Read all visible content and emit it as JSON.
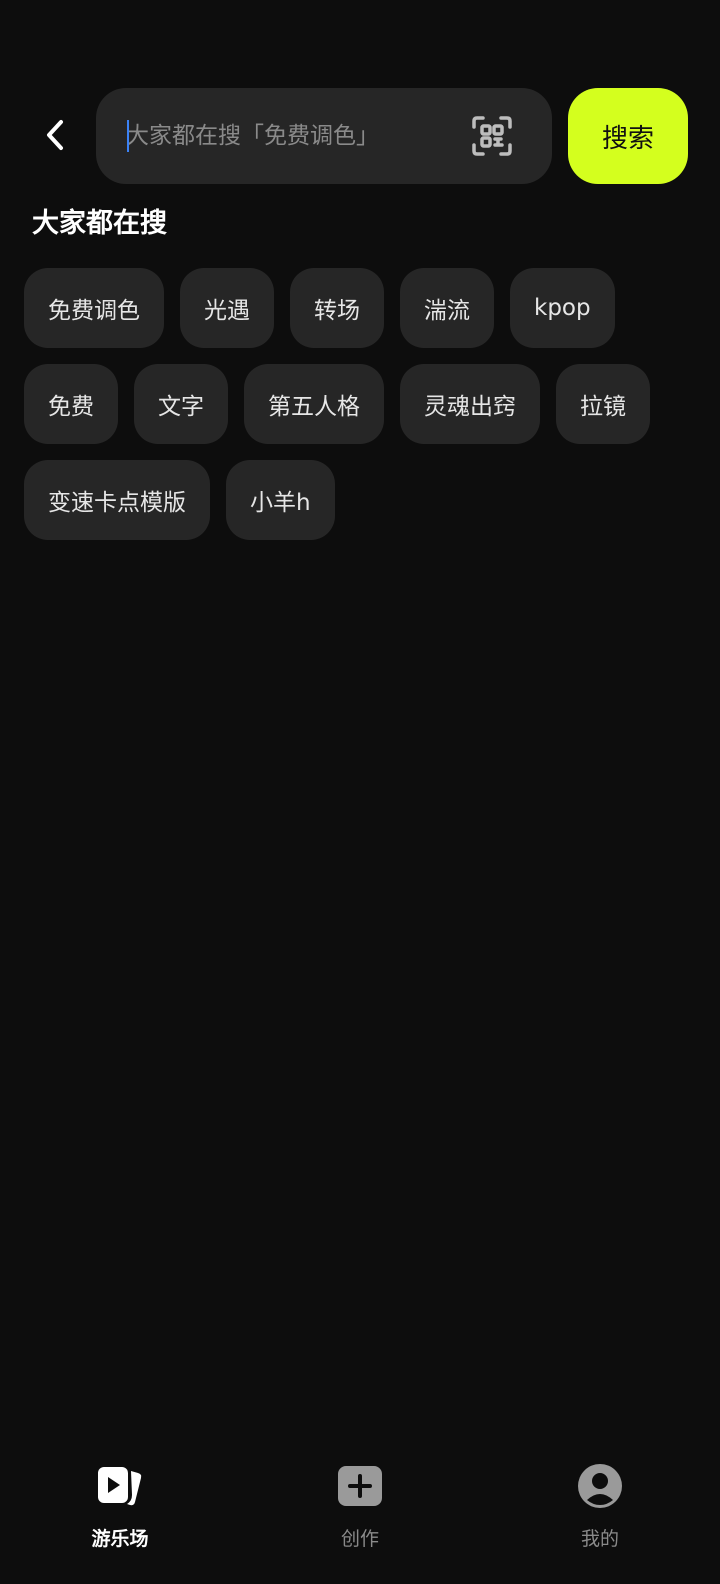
{
  "header": {
    "back_icon": "chevron-left-icon",
    "search_placeholder": "大家都在搜「免费调色」",
    "search_value": "",
    "scan_icon": "scan-icon",
    "search_button_label": "搜索",
    "accent_color": "#d4ff1e"
  },
  "trending": {
    "title": "大家都在搜",
    "chips": [
      "免费调色",
      "光遇",
      "转场",
      "湍流",
      "kpop",
      "免费",
      "文字",
      "第五人格",
      "灵魂出窍",
      "拉镜",
      "变速卡点模版",
      "小羊h"
    ]
  },
  "bottom_nav": {
    "items": [
      {
        "label": "游乐场",
        "icon": "playground-icon",
        "active": true
      },
      {
        "label": "创作",
        "icon": "create-plus-icon",
        "active": false
      },
      {
        "label": "我的",
        "icon": "profile-icon",
        "active": false
      }
    ]
  }
}
